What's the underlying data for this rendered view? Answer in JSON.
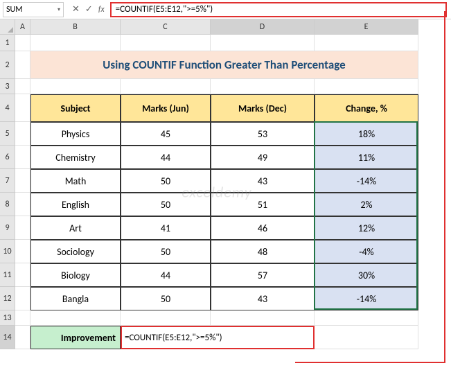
{
  "nameBox": "SUM",
  "formulaBar": "=COUNTIF(E5:E12,\">=5%\")",
  "columns": [
    "A",
    "B",
    "C",
    "D",
    "E"
  ],
  "rowNumbers": [
    "1",
    "2",
    "3",
    "4",
    "5",
    "6",
    "7",
    "8",
    "9",
    "10",
    "11",
    "12",
    "13",
    "14"
  ],
  "title": "Using COUNTIF Function Greater Than Percentage",
  "headers": {
    "subject": "Subject",
    "jun": "Marks (Jun)",
    "dec": "Marks (Dec)",
    "change": "Change, %"
  },
  "rows": [
    {
      "subject": "Physics",
      "jun": "45",
      "dec": "53",
      "change": "18%"
    },
    {
      "subject": "Chemistry",
      "jun": "44",
      "dec": "49",
      "change": "11%"
    },
    {
      "subject": "Math",
      "jun": "50",
      "dec": "43",
      "change": "-14%"
    },
    {
      "subject": "English",
      "jun": "50",
      "dec": "51",
      "change": "2%"
    },
    {
      "subject": "Art",
      "jun": "41",
      "dec": "46",
      "change": "12%"
    },
    {
      "subject": "Sociology",
      "jun": "50",
      "dec": "48",
      "change": "-4%"
    },
    {
      "subject": "Biology",
      "jun": "44",
      "dec": "57",
      "change": "30%"
    },
    {
      "subject": "Bangla",
      "jun": "50",
      "dec": "43",
      "change": "-14%"
    }
  ],
  "improvement": {
    "label": "Improvement",
    "value": "=COUNTIF(E5:E12,\">=5%\")"
  },
  "watermark": "exceldemy",
  "icons": {
    "down": "▾",
    "cancel": "✕",
    "enter": "✓"
  },
  "colors": {
    "annot": "#e03030",
    "select": "#217346"
  },
  "chart_data": {
    "type": "table",
    "title": "Using COUNTIF Function Greater Than Percentage",
    "columns": [
      "Subject",
      "Marks (Jun)",
      "Marks (Dec)",
      "Change, %"
    ],
    "rows": [
      [
        "Physics",
        45,
        53,
        0.18
      ],
      [
        "Chemistry",
        44,
        49,
        0.11
      ],
      [
        "Math",
        50,
        43,
        -0.14
      ],
      [
        "English",
        50,
        51,
        0.02
      ],
      [
        "Art",
        41,
        46,
        0.12
      ],
      [
        "Sociology",
        50,
        48,
        -0.04
      ],
      [
        "Biology",
        44,
        57,
        0.3
      ],
      [
        "Bangla",
        50,
        43,
        -0.14
      ]
    ]
  }
}
